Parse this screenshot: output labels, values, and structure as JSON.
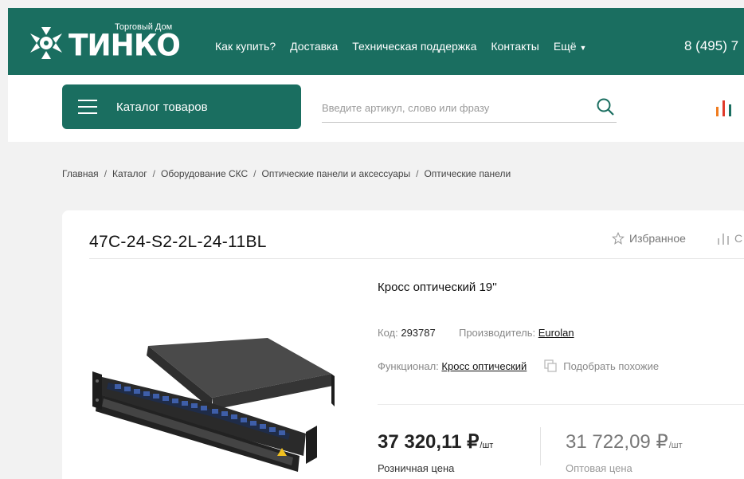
{
  "header": {
    "logo_subtitle": "Торговый Дом",
    "logo_brand": "ТИНКО",
    "nav": [
      "Как купить?",
      "Доставка",
      "Техническая поддержка",
      "Контакты",
      "Ещё"
    ],
    "phone": "8 (495) 7"
  },
  "search_bar": {
    "catalog_label": "Каталог товаров",
    "placeholder": "Введите артикул, слово или фразу"
  },
  "breadcrumb": [
    "Главная",
    "Каталог",
    "Оборудование СКС",
    "Оптические панели и аксессуары",
    "Оптические панели"
  ],
  "product": {
    "sku": "47C-24-S2-2L-24-11BL",
    "favorite_label": "Избранное",
    "compare_label": "С",
    "title": "Кросс оптический 19''",
    "code_label": "Код:",
    "code_value": "293787",
    "manufacturer_label": "Производитель:",
    "manufacturer_value": "Eurolan",
    "function_label": "Функционал:",
    "function_value": "Кросс оптический",
    "similar_label": "Подобрать похожие",
    "retail_price": "37 320,11",
    "wholesale_price": "31 722,09",
    "currency": "₽",
    "unit": "/шт",
    "retail_label": "Розничная цена",
    "wholesale_label": "Оптовая цена"
  },
  "colors": {
    "brand": "#1a6e60",
    "accent_orange": "#f07c1f",
    "accent_red": "#e03a2a",
    "accent_green": "#1a6e60"
  }
}
